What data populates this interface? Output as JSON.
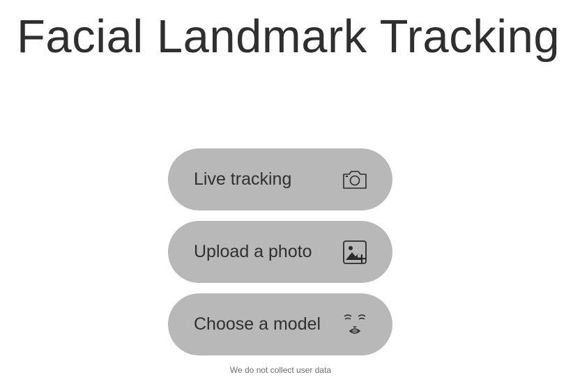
{
  "page": {
    "title": "Facial Landmark Tracking"
  },
  "menu": {
    "items": [
      {
        "label": "Live tracking",
        "icon": "camera-icon"
      },
      {
        "label": "Upload a photo",
        "icon": "add-photo-icon"
      },
      {
        "label": "Choose a model",
        "icon": "face-icon"
      }
    ]
  },
  "footer": {
    "note": "We do not collect user data"
  },
  "colors": {
    "background": "#ffffff",
    "button": "#b8b8b8",
    "text": "#303030",
    "title": "#2f2f2f",
    "note": "#6e6e6e"
  }
}
